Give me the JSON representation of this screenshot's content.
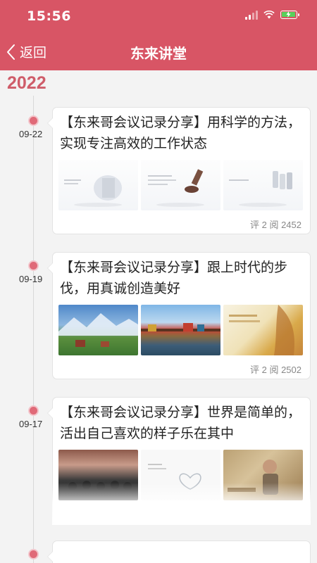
{
  "status_bar": {
    "time": "15:56"
  },
  "nav": {
    "back_label": "返回",
    "title": "东来讲堂"
  },
  "timeline": {
    "year": "2022"
  },
  "entries": [
    {
      "date": "09-22",
      "title": "【东来哥会议记录分享】用科学的方法，实现专注高效的工作状态",
      "meta": "评 2 阅 2452"
    },
    {
      "date": "09-19",
      "title": "【东来哥会议记录分享】跟上时代的步伐，用真诚创造美好",
      "meta": "评 2 阅 2502"
    },
    {
      "date": "09-17",
      "title": "【东来哥会议记录分享】世界是简单的，活出自己喜欢的样子乐在其中",
      "meta": ""
    }
  ],
  "colors": {
    "header": "#d85565",
    "accent": "#cf5d6a",
    "dot": "#e06a78",
    "battery": "#57d15b"
  },
  "icons": {
    "back": "chevron-left-icon",
    "signal": "signal-icon",
    "wifi": "wifi-icon",
    "battery": "battery-icon"
  }
}
